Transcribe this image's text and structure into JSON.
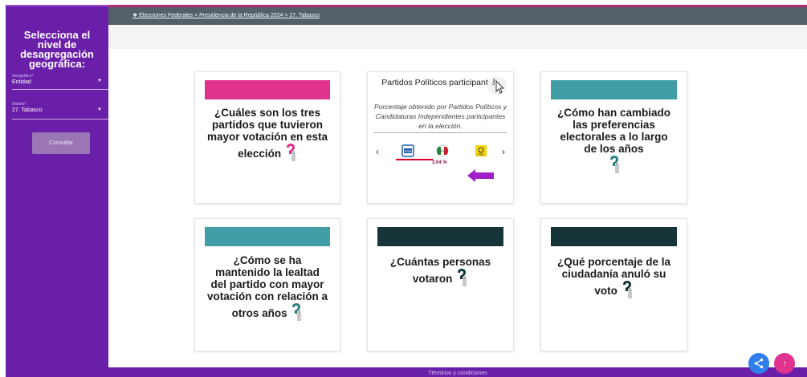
{
  "sidebar": {
    "title": "Selecciona el nivel de desagregación geográfica:",
    "geografico_label": "Geográfico*",
    "geografico_value": "Entidad",
    "distrito_label": "Distrito*",
    "distrito_value": "27. Tabasco",
    "consult_label": "Consultar"
  },
  "topbar": {
    "breadcrumb": "Elecciones Federales > Presidencia de la República 2024 > 27. Tabasco"
  },
  "cards": {
    "top_votes": "¿Cuáles son los tres partidos que tuvieron mayor votación en esta elección",
    "preferences": "¿Cómo han cambiado las preferencias electorales a lo largo de los años",
    "loyalty": "¿Cómo se ha mantenido la lealtad del partido con mayor votación con relación a otros años",
    "voters": "¿Cuántas personas votaron",
    "null_votes": "¿Qué porcentaje de la ciudadanía anuló su voto"
  },
  "center_card": {
    "title": "Partidos Políticos participantes.",
    "description": "Porcentaje obtenido por Partidos Políticos y Candidaturas Independientes participantes en la elección.",
    "percentage": "3.04 %",
    "logos": [
      "PAN",
      "PRI",
      "PRD"
    ]
  },
  "footer": {
    "text": "Términos y condiciones"
  },
  "colors": {
    "sidebar": "#6a1fa9",
    "pink": "#e0338d",
    "teal": "#419da6",
    "dark_teal": "#173538",
    "fab_blue": "#2f80ed",
    "fab_pink": "#e0338d"
  }
}
